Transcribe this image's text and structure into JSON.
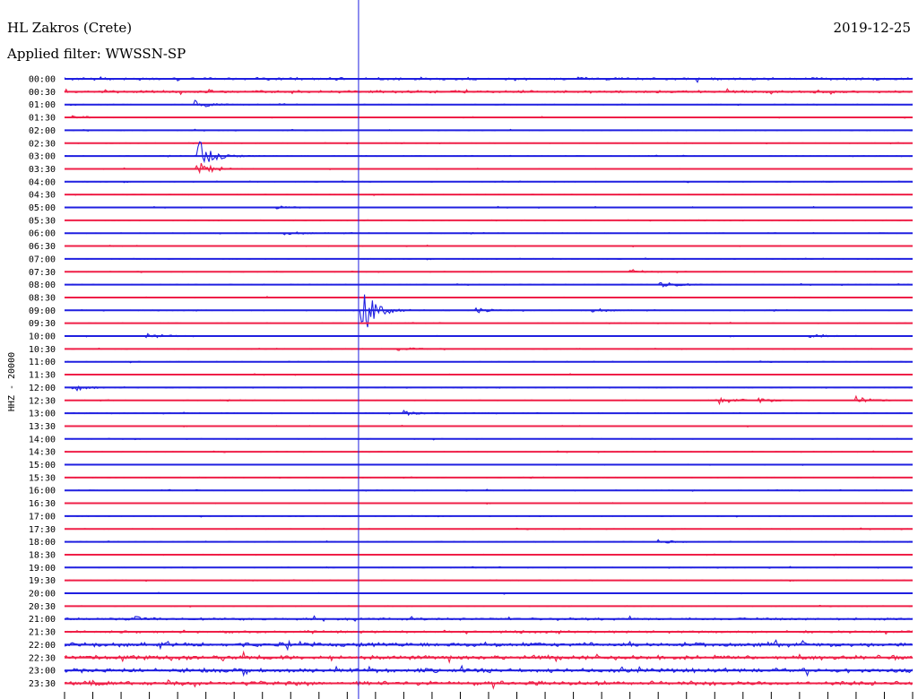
{
  "header": {
    "station": "HL Zakros (Crete)",
    "date": "2019-12-25",
    "filter_label": "Applied filter: WWSSN-SP"
  },
  "chart_data": {
    "type": "line",
    "title": "HL Zakros (Crete)",
    "subtitle": "Applied filter: WWSSN-SP",
    "date": "2019-12-25",
    "ylabel": "HHZ - 20000",
    "row_labels": [
      "00:00",
      "00:30",
      "01:00",
      "01:30",
      "02:00",
      "02:30",
      "03:00",
      "03:30",
      "04:00",
      "04:30",
      "05:00",
      "05:30",
      "06:00",
      "06:30",
      "07:00",
      "07:30",
      "08:00",
      "08:30",
      "09:00",
      "09:30",
      "10:00",
      "10:30",
      "11:00",
      "11:30",
      "12:00",
      "12:30",
      "13:00",
      "13:30",
      "14:00",
      "14:30",
      "15:00",
      "15:30",
      "16:00",
      "16:30",
      "17:00",
      "17:30",
      "18:00",
      "18:30",
      "19:00",
      "19:30",
      "20:00",
      "20:30",
      "21:00",
      "21:30",
      "22:00",
      "22:30",
      "23:00",
      "23:30"
    ],
    "x_unit": "minutes within row",
    "xlim": [
      0,
      30
    ],
    "x_ticks": [
      0,
      1,
      2,
      3,
      4,
      5,
      6,
      7,
      8,
      9,
      10,
      11,
      12,
      13,
      14,
      15,
      16,
      17,
      18,
      19,
      20,
      21,
      22,
      23,
      24,
      25,
      26,
      27,
      28,
      29,
      30
    ],
    "grid": false,
    "colors": [
      "#1f1fe0",
      "#ef1f47"
    ],
    "marker_minute": 10.4,
    "noise": [
      {
        "rows": [
          0,
          1
        ],
        "level": 0.5
      },
      {
        "rows": [
          42,
          43
        ],
        "level": 0.45
      },
      {
        "rows": [
          44,
          47
        ],
        "level": 0.85
      }
    ],
    "events": [
      {
        "row": 2,
        "minute": 4.6,
        "amp": 2.2
      },
      {
        "row": 3,
        "minute": 0.3,
        "amp": 1.2
      },
      {
        "row": 6,
        "minute": 4.7,
        "amp": 9.0
      },
      {
        "row": 7,
        "minute": 4.7,
        "amp": 5.0
      },
      {
        "row": 10,
        "minute": 7.5,
        "amp": 1.0
      },
      {
        "row": 12,
        "minute": 7.8,
        "amp": 1.2
      },
      {
        "row": 15,
        "minute": 20.0,
        "amp": 1.3
      },
      {
        "row": 16,
        "minute": 21.1,
        "amp": 2.0
      },
      {
        "row": 18,
        "minute": 10.5,
        "amp": 14.0
      },
      {
        "row": 18,
        "minute": 14.6,
        "amp": 1.2
      },
      {
        "row": 18,
        "minute": 18.6,
        "amp": 1.3
      },
      {
        "row": 20,
        "minute": 2.9,
        "amp": 1.8
      },
      {
        "row": 20,
        "minute": 26.3,
        "amp": 1.3
      },
      {
        "row": 21,
        "minute": 11.8,
        "amp": 1.0
      },
      {
        "row": 24,
        "minute": 0.3,
        "amp": 1.8
      },
      {
        "row": 25,
        "minute": 23.2,
        "amp": 1.6
      },
      {
        "row": 25,
        "minute": 24.6,
        "amp": 1.2
      },
      {
        "row": 25,
        "minute": 28.0,
        "amp": 2.0
      },
      {
        "row": 26,
        "minute": 12.0,
        "amp": 1.4
      },
      {
        "row": 36,
        "minute": 21.0,
        "amp": 0.9
      },
      {
        "row": 42,
        "minute": 2.4,
        "amp": 1.2
      }
    ]
  }
}
